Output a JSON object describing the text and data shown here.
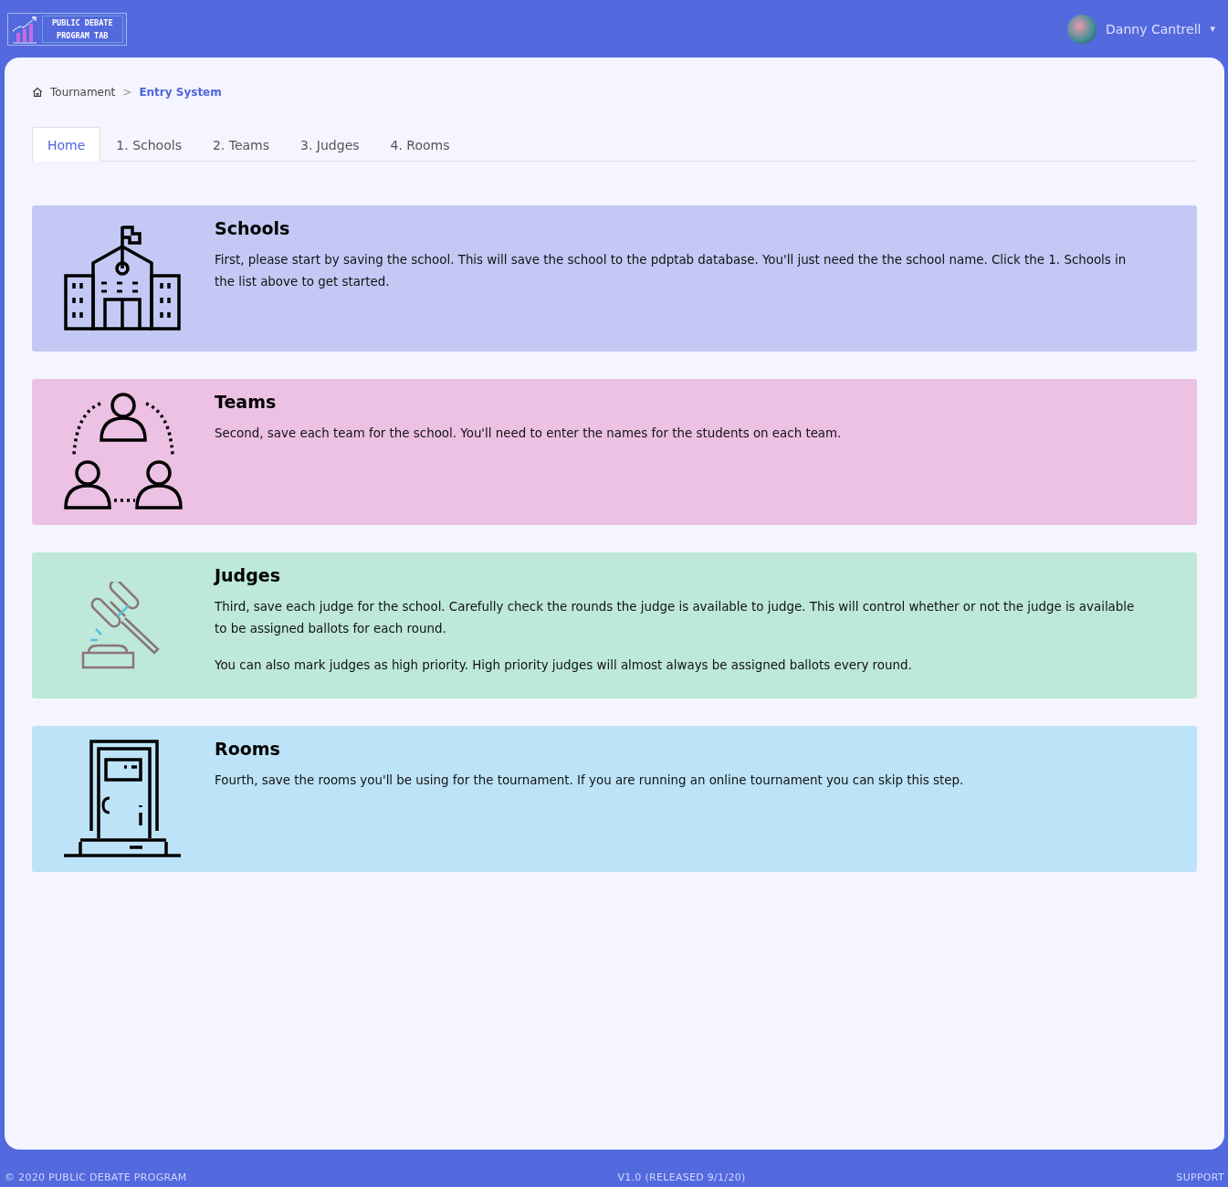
{
  "header": {
    "logo_lines": [
      "PUBLIC DEBATE",
      "PROGRAM TAB"
    ],
    "user": {
      "name": "Danny Cantrell",
      "caret": "▾"
    }
  },
  "breadcrumb": {
    "items": [
      "Tournament",
      "Entry System"
    ],
    "separator": ">"
  },
  "tabs": [
    {
      "label": "Home",
      "selected": true
    },
    {
      "label": "1. Schools",
      "selected": false
    },
    {
      "label": "2. Teams",
      "selected": false
    },
    {
      "label": "3. Judges",
      "selected": false
    },
    {
      "label": "4. Rooms",
      "selected": false
    }
  ],
  "cards": [
    {
      "kind": "schools",
      "color": "#c3c9f4",
      "title": "Schools",
      "paragraphs": [
        "First, please start by saving the school. This will save the school to the pdptab database. You'll just need the the school name. Click the 1. Schools in the list above to get started."
      ]
    },
    {
      "kind": "teams",
      "color": "#ecc1e4",
      "title": "Teams",
      "paragraphs": [
        "Second, save each team for the school. You'll need to enter the names for the students on each team."
      ]
    },
    {
      "kind": "judges",
      "color": "#bde8da",
      "title": "Judges",
      "paragraphs": [
        "Third, save each judge for the school. Carefully check the rounds the judge is available to judge. This will control whether or not the judge is available to be assigned ballots for each round.",
        "You can also mark judges as high priority. High priority judges will almost always be assigned ballots every round."
      ]
    },
    {
      "kind": "rooms",
      "color": "#bde3f8",
      "title": "Rooms",
      "paragraphs": [
        "Fourth, save the rooms you'll be using for the tournament. If you are running an online tournament you can skip this step."
      ]
    }
  ],
  "footer": {
    "left": "© 2020 PUBLIC DEBATE PROGRAM",
    "center": "V1.0 (RELEASED 9/1/20)",
    "right": "SUPPORT"
  }
}
